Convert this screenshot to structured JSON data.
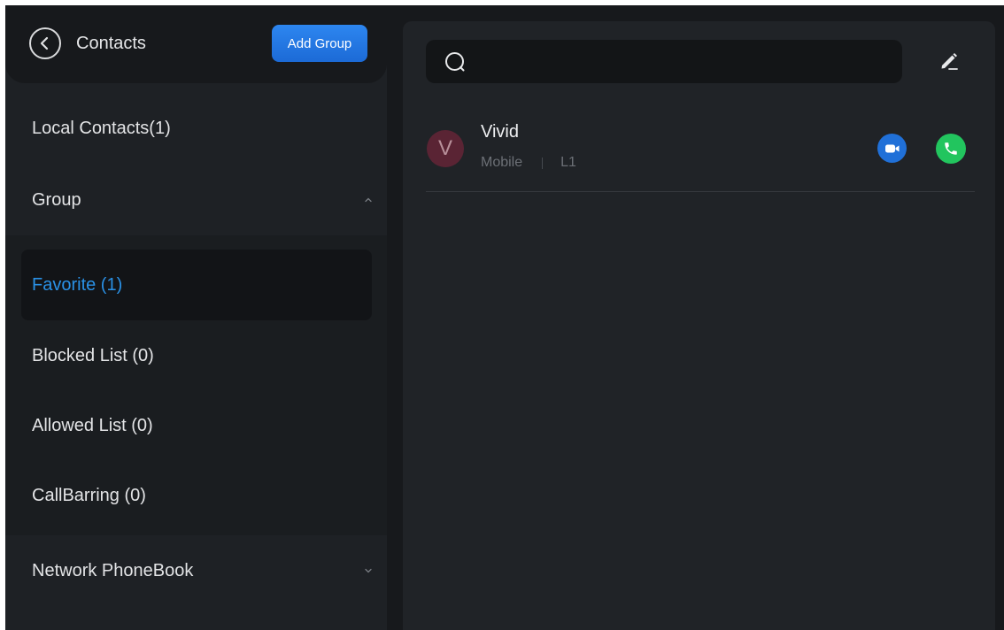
{
  "header": {
    "title": "Contacts",
    "add_group_label": "Add Group"
  },
  "sidebar": {
    "local_contacts": "Local Contacts(1)",
    "group_label": "Group",
    "groups": [
      {
        "label": "Favorite  (1)",
        "selected": true
      },
      {
        "label": "Blocked List  (0)",
        "selected": false
      },
      {
        "label": "Allowed List  (0)",
        "selected": false
      },
      {
        "label": "CallBarring  (0)",
        "selected": false
      }
    ],
    "network_phonebook": "Network PhoneBook"
  },
  "search": {
    "value": "",
    "placeholder": ""
  },
  "contacts": [
    {
      "initial": "V",
      "name": "Vivid",
      "type": "Mobile",
      "line": "L1"
    }
  ],
  "icons": {
    "back": "chevron-left-icon",
    "search": "search-icon",
    "edit": "edit-pencil-icon",
    "video": "video-call-icon",
    "call": "phone-call-icon",
    "group_expanded": "chevron-up-icon",
    "network_collapsed": "chevron-down-icon"
  },
  "colors": {
    "accent_blue": "#2a91e6",
    "button_blue": "#2070d8",
    "call_green": "#22c55e",
    "avatar_bg": "#5a2434"
  }
}
